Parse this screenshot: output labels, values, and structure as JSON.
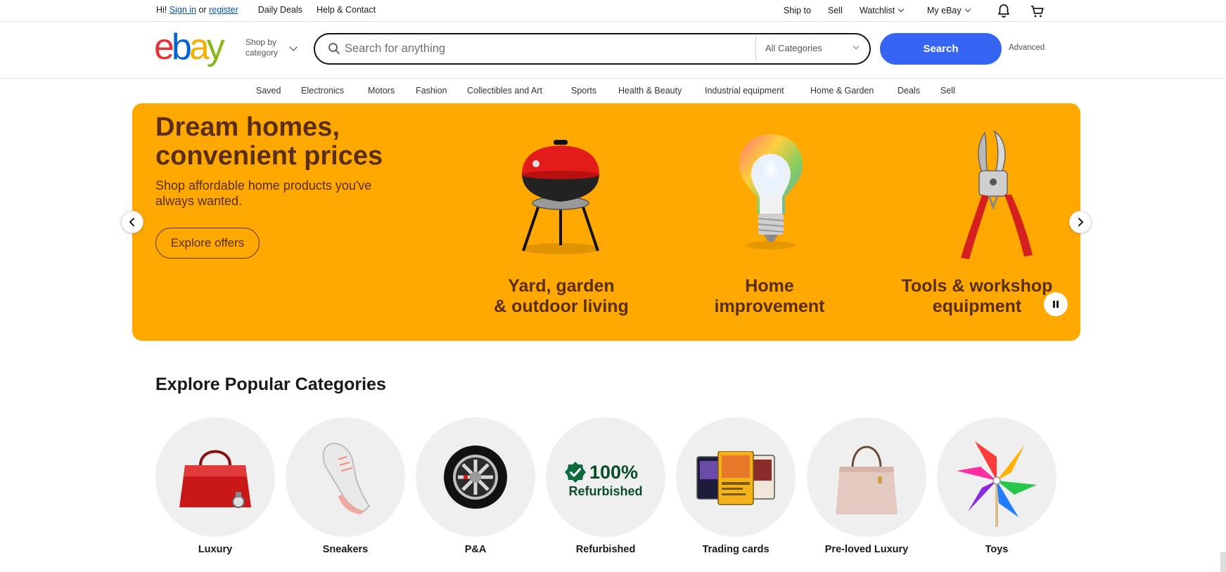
{
  "topbar": {
    "greeting_prefix": "Hi!",
    "sign_in": "Sign in",
    "or": "or",
    "register": "register",
    "daily_deals": "Daily Deals",
    "help_contact": "Help & Contact",
    "ship_to": "Ship to",
    "sell": "Sell",
    "watchlist": "Watchlist",
    "my_ebay": "My eBay"
  },
  "header": {
    "logo": [
      "e",
      "b",
      "a",
      "y"
    ],
    "shop_by_line1": "Shop by",
    "shop_by_line2": "category",
    "search_placeholder": "Search for anything",
    "category_select": "All Categories",
    "search_button": "Search",
    "advanced": "Advanced"
  },
  "nav": {
    "items": [
      "Saved",
      "Electronics",
      "Motors",
      "Fashion",
      "Collectibles and Art",
      "Sports",
      "Health & Beauty",
      "Industrial equipment",
      "Home & Garden",
      "Deals",
      "Sell"
    ]
  },
  "hero": {
    "title": "Dream homes, convenient prices",
    "subtitle": "Shop affordable home products you've always wanted.",
    "cta": "Explore offers",
    "tiles": [
      {
        "line1": "Yard, garden",
        "line2": "& outdoor living",
        "icon": "grill-icon"
      },
      {
        "line1": "Home",
        "line2": "improvement",
        "icon": "lightbulb-icon"
      },
      {
        "line1": "Tools & workshop",
        "line2": "equipment",
        "icon": "pruning-shears-icon"
      }
    ]
  },
  "categories": {
    "title": "Explore Popular Categories",
    "items": [
      "Luxury",
      "Sneakers",
      "P&A",
      "Refurbished",
      "Trading cards",
      "Pre-loved Luxury",
      "Toys"
    ],
    "refurbished_badge_top": "100%",
    "refurbished_badge_bottom": "Refurbished"
  },
  "colors": {
    "hero_bg": "#ffa800",
    "hero_text": "#592e13",
    "search_button": "#3665f3",
    "link": "#0654ba"
  }
}
